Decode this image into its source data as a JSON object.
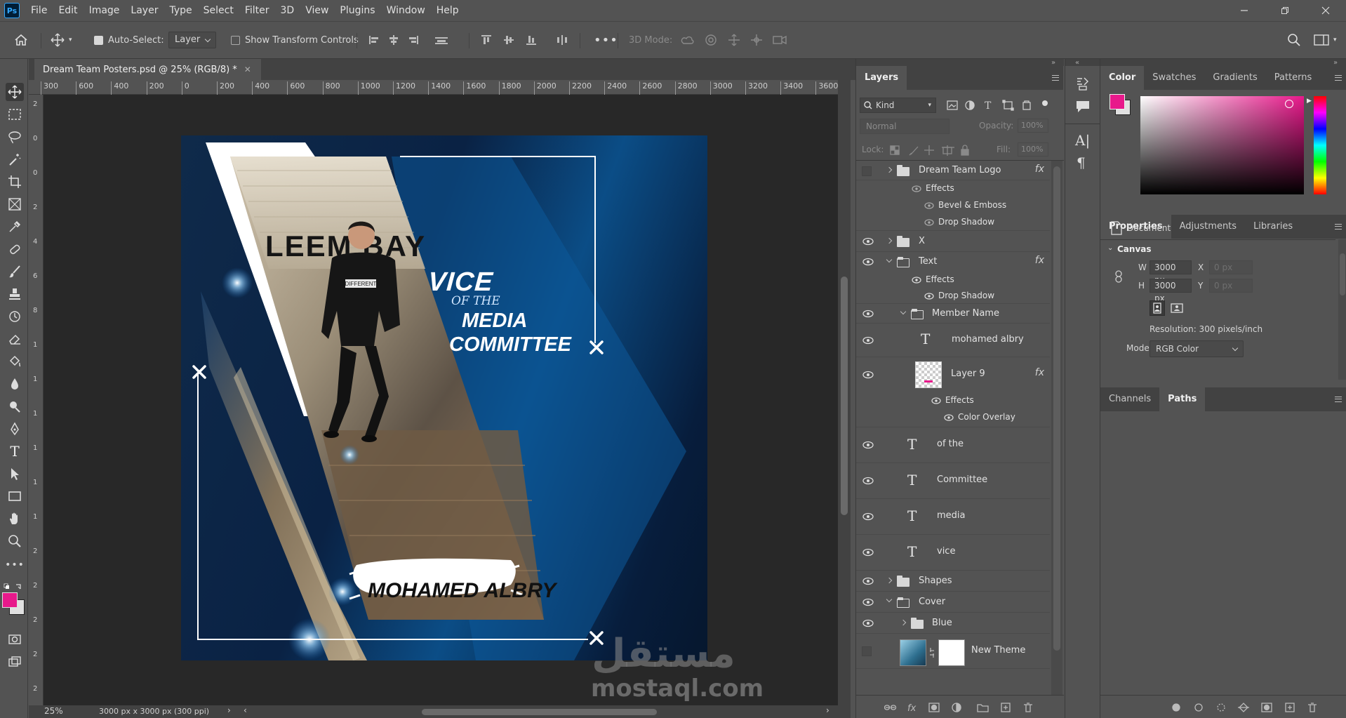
{
  "app": {
    "logo_text": "Ps"
  },
  "menu": [
    "File",
    "Edit",
    "Image",
    "Layer",
    "Type",
    "Select",
    "Filter",
    "3D",
    "View",
    "Plugins",
    "Window",
    "Help"
  ],
  "options_bar": {
    "auto_select_label": "Auto-Select:",
    "auto_select_value": "Layer",
    "transform_label": "Show Transform Controls",
    "mode_3d_label": "3D Mode:"
  },
  "document": {
    "tab_title": "Dream Team Posters.psd @ 25% (RGB/8) *",
    "zoom": "25%",
    "doc_info": "3000 px x 3000 px (300 ppi)",
    "ruler_h": [
      "300",
      "600",
      "400",
      "200",
      "0",
      "200",
      "400",
      "600",
      "800",
      "1000",
      "1200",
      "1400",
      "1600",
      "1800",
      "2000",
      "2200",
      "2400",
      "2600",
      "2800",
      "3000",
      "3200",
      "3400",
      "3600"
    ],
    "ruler_v": [
      "2",
      "0",
      "0",
      "2",
      "4",
      "6",
      "8",
      "1",
      "1",
      "1",
      "1",
      "1",
      "1",
      "2",
      "2",
      "2",
      "2",
      "2"
    ]
  },
  "poster": {
    "line1": "VICE",
    "line2": "OF THE",
    "line3": "MEDIA",
    "line4": "COMMITTEE",
    "name": "MOHAMED ALBRY",
    "sign_text": "LEEM BAY",
    "shirt_text": "DIFFERENT"
  },
  "watermark": {
    "arabic": "مستقل",
    "latin": "mostaql.com"
  },
  "layers_panel": {
    "title": "Layers",
    "filter_kind": "Kind",
    "blend_mode": "Normal",
    "opacity_label": "Opacity:",
    "opacity_value": "100%",
    "lock_label": "Lock:",
    "fill_label": "Fill:",
    "fill_value": "100%",
    "layers": [
      {
        "name": "Dream Team Logo"
      },
      {
        "name": "Effects"
      },
      {
        "name": "Bevel & Emboss"
      },
      {
        "name": "Drop Shadow"
      },
      {
        "name": "X"
      },
      {
        "name": "Text"
      },
      {
        "name": "Effects"
      },
      {
        "name": "Drop Shadow"
      },
      {
        "name": "Member Name"
      },
      {
        "name": "mohamed albry"
      },
      {
        "name": "Layer 9"
      },
      {
        "name": "Effects"
      },
      {
        "name": "Color Overlay"
      },
      {
        "name": "of the"
      },
      {
        "name": "Committee"
      },
      {
        "name": "media"
      },
      {
        "name": "vice"
      },
      {
        "name": "Shapes"
      },
      {
        "name": "Cover"
      },
      {
        "name": "Blue"
      },
      {
        "name": "New Theme"
      }
    ],
    "fx_label": "fx"
  },
  "color_panel": {
    "tabs": [
      "Color",
      "Swatches",
      "Gradients",
      "Patterns"
    ],
    "foreground": "#e8198b",
    "background": "#e0e0e0"
  },
  "properties_panel": {
    "tabs": [
      "Properties",
      "Adjustments",
      "Libraries"
    ],
    "doc_label": "Document",
    "section": "Canvas",
    "w_label": "W",
    "w_value": "3000 px",
    "h_label": "H",
    "h_value": "3000 px",
    "x_label": "X",
    "x_placeholder": "0 px",
    "y_label": "Y",
    "y_placeholder": "0 px",
    "resolution": "Resolution: 300 pixels/inch",
    "mode_label": "Mode",
    "mode_value": "RGB Color"
  },
  "channels_panel": {
    "tabs": [
      "Channels",
      "Paths"
    ]
  }
}
